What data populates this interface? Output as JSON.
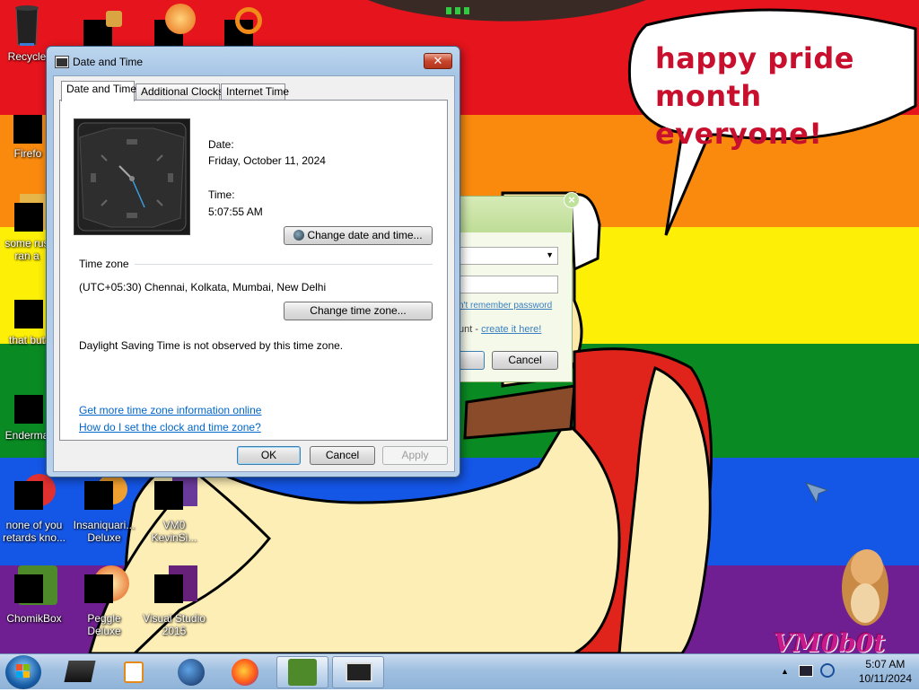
{
  "wallpaper": {
    "speech_text": "happy pride month everyone!",
    "watermark": "VM0b0t"
  },
  "desktop_icons": [
    {
      "name": "recycle-bin",
      "label": "Recycle"
    },
    {
      "name": "firefox",
      "label": "Firefo"
    },
    {
      "name": "some-rus",
      "label": "some rus\nran a"
    },
    {
      "name": "that-but",
      "label": "that but"
    },
    {
      "name": "enderman",
      "label": "Enderma"
    },
    {
      "name": "none-of-you",
      "label": "none of you\nretards kno..."
    },
    {
      "name": "insaniquarium",
      "label": "Insaniquari...\nDeluxe"
    },
    {
      "name": "vm0-kevin",
      "label": "VM0\nKevinSi..."
    },
    {
      "name": "chomikbox",
      "label": "ChomikBox"
    },
    {
      "name": "peggle",
      "label": "Peggle Deluxe"
    },
    {
      "name": "visual-studio",
      "label": "Visual Studio\n2015"
    }
  ],
  "dialog": {
    "title": "Date and Time",
    "tabs": [
      "Date and Time",
      "Additional Clocks",
      "Internet Time"
    ],
    "active_tab": "Date and Time",
    "date_label": "Date:",
    "date_value": "Friday, October 11, 2024",
    "time_label": "Time:",
    "time_value": "5:07:55 AM",
    "change_datetime_button": "Change date and time...",
    "timezone_heading": "Time zone",
    "timezone_value": "(UTC+05:30) Chennai, Kolkata, Mumbai, New Delhi",
    "change_timezone_button": "Change time zone...",
    "dst_note": "Daylight Saving Time is not observed by this time zone.",
    "link_more_info": "Get more time zone information online",
    "link_how_set": "How do I set the clock and time zone?",
    "ok_button": "OK",
    "cancel_button": "Cancel",
    "apply_button": "Apply"
  },
  "background_window": {
    "forgot_link": "n't remember password",
    "account_text": "unt - ",
    "create_link": "create it here!",
    "cancel_button": "Cancel"
  },
  "taskbar": {
    "clock_time": "5:07 AM",
    "clock_date": "10/11/2024"
  }
}
